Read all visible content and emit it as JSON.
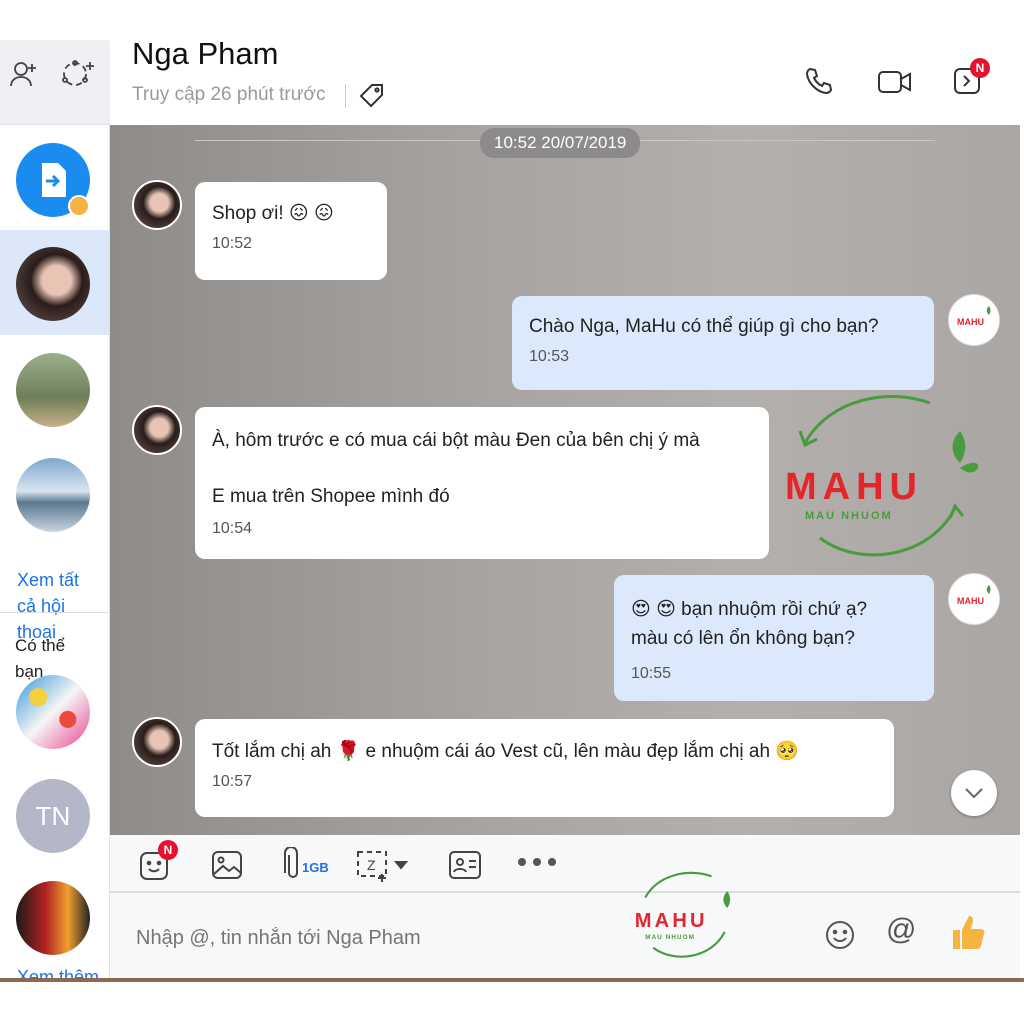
{
  "header": {
    "name": "Nga Pham",
    "status": "Truy cập 26 phút trước",
    "notify_badge": "N"
  },
  "sidebar": {
    "see_all": "Xem tất cả hội thoại",
    "suggest": "Có thể bạn quen",
    "avatar_initials": "TN",
    "see_more": "Xem thêm"
  },
  "chat": {
    "date": "10:52 20/07/2019",
    "messages": [
      {
        "dir": "in",
        "lines": [
          "Shop ơi! 😖 😖"
        ],
        "time": "10:52"
      },
      {
        "dir": "out",
        "lines": [
          "Chào Nga, MaHu có thể giúp gì cho bạn?"
        ],
        "time": "10:53"
      },
      {
        "dir": "in",
        "lines": [
          "À, hôm trước e có mua cái bột màu Đen của bên chị ý mà",
          "",
          "E mua trên Shopee mình đó"
        ],
        "time": "10:54"
      },
      {
        "dir": "out",
        "lines": [
          "😍 😍 bạn nhuộm rồi chứ ạ?",
          "màu có lên ổn không bạn?"
        ],
        "time": "10:55"
      },
      {
        "dir": "in",
        "lines": [
          "Tốt lắm chị ah 🌹 e nhuộm cái áo Vest cũ, lên màu đẹp lắm chị ah 🥺"
        ],
        "time": "10:57"
      }
    ],
    "watermark": {
      "brand": "MAHU",
      "tagline": "MAU NHUOM"
    }
  },
  "toolbar": {
    "sticker_badge": "N",
    "file_limit": "1GB"
  },
  "input": {
    "placeholder": "Nhập @, tin nhắn tới Nga Pham"
  },
  "colors": {
    "accent": "#0068ff",
    "out_bubble": "#dce8fc",
    "badge": "#e8112d",
    "brand_red": "#e3262b",
    "brand_green": "#4a9b3f"
  }
}
